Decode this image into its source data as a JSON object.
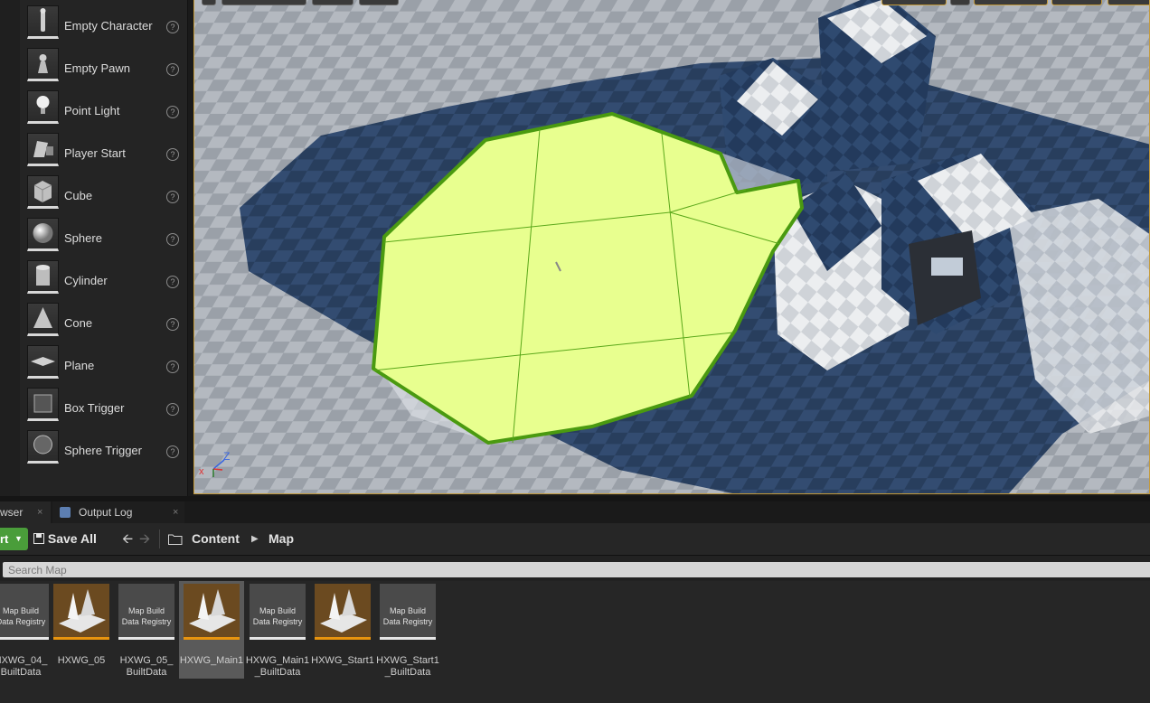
{
  "place_actors": {
    "items": [
      {
        "label": "Empty Character",
        "icon": "character-icon"
      },
      {
        "label": "Empty Pawn",
        "icon": "pawn-icon"
      },
      {
        "label": "Point Light",
        "icon": "lightbulb-icon"
      },
      {
        "label": "Player Start",
        "icon": "player-start-icon"
      },
      {
        "label": "Cube",
        "icon": "cube-icon"
      },
      {
        "label": "Sphere",
        "icon": "sphere-icon"
      },
      {
        "label": "Cylinder",
        "icon": "cylinder-icon"
      },
      {
        "label": "Cone",
        "icon": "cone-icon"
      },
      {
        "label": "Plane",
        "icon": "plane-icon"
      },
      {
        "label": "Box Trigger",
        "icon": "box-trigger-icon"
      },
      {
        "label": "Sphere Trigger",
        "icon": "sphere-trigger-icon"
      }
    ],
    "help_glyph": "?"
  },
  "viewport": {
    "axis_labels": {
      "x": "x",
      "z": "Z"
    },
    "selection_color": "#e8ff8f",
    "selection_outline": "#4a9a10"
  },
  "tabs": {
    "content_browser": "wser",
    "output_log": "Output Log",
    "close_glyph": "×"
  },
  "toolbar": {
    "add_import": "rt",
    "save_all": "Save All",
    "breadcrumbs": [
      "Content",
      "Map"
    ],
    "accent": "#4a9d3a"
  },
  "search": {
    "placeholder": "Search Map"
  },
  "assets": [
    {
      "name": "HXWG_04_\nBuiltData",
      "kind": "registry",
      "thumb_text": "Map Build\nData Registry",
      "selected": false
    },
    {
      "name": "HXWG_05",
      "kind": "level",
      "selected": false
    },
    {
      "name": "HXWG_05_\nBuiltData",
      "kind": "registry",
      "thumb_text": "Map Build\nData Registry",
      "selected": false
    },
    {
      "name": "HXWG_Main1",
      "kind": "level",
      "selected": true
    },
    {
      "name": "HXWG_Main1\n_BuiltData",
      "kind": "registry",
      "thumb_text": "Map Build\nData Registry",
      "selected": false
    },
    {
      "name": "HXWG_Start1",
      "kind": "level",
      "selected": false
    },
    {
      "name": "HXWG_Start1\n_BuiltData",
      "kind": "registry",
      "thumb_text": "Map Build\nData Registry",
      "selected": false
    }
  ]
}
